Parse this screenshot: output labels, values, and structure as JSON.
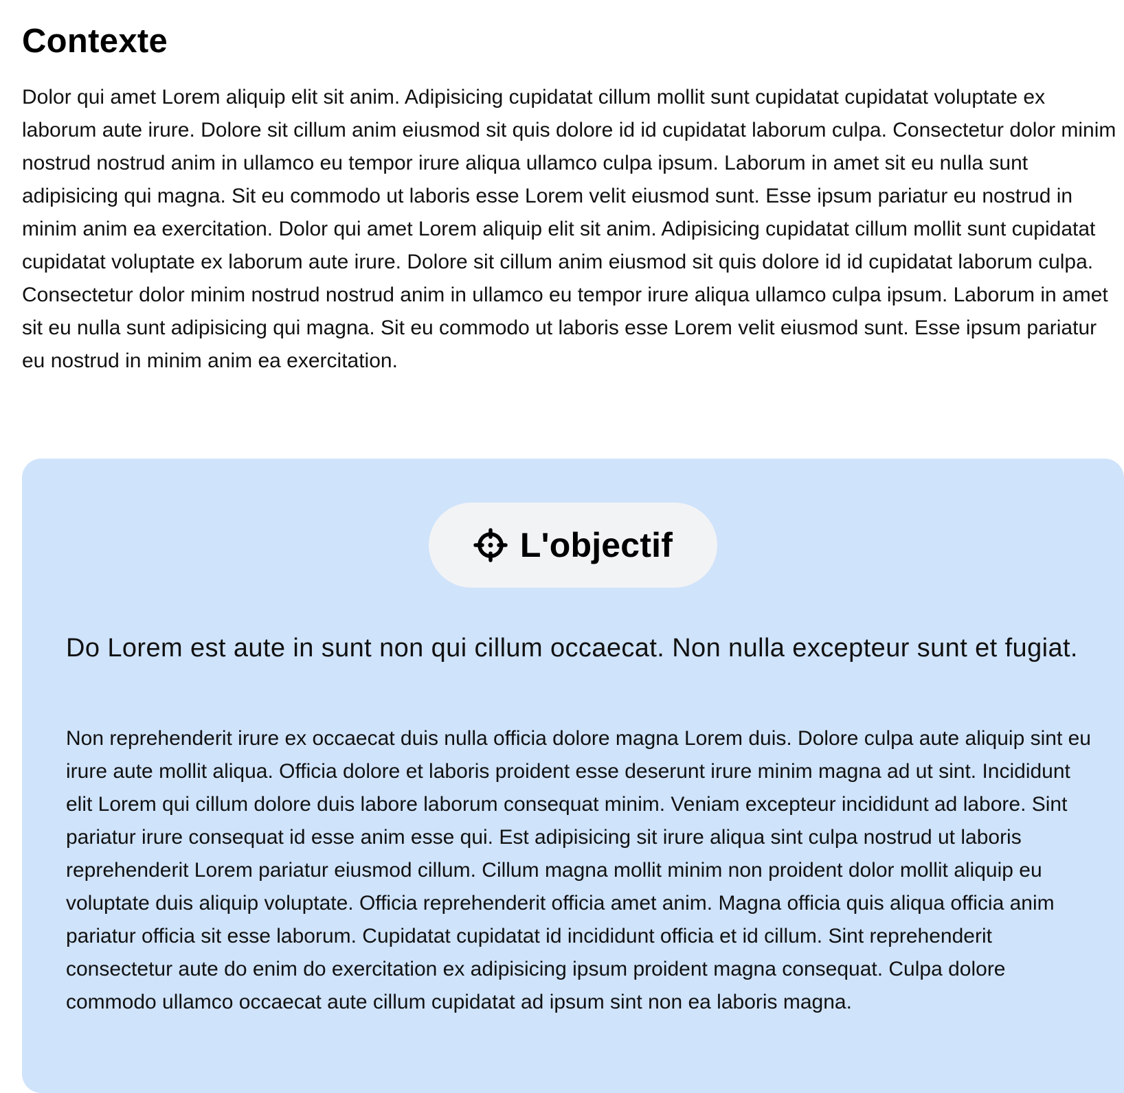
{
  "context": {
    "title": "Contexte",
    "body": "Dolor qui amet Lorem aliquip elit sit anim. Adipisicing cupidatat cillum mollit sunt cupidatat cupidatat voluptate ex laborum aute irure. Dolore sit cillum anim eiusmod sit quis dolore id id cupidatat laborum culpa. Consectetur dolor minim nostrud nostrud anim in ullamco eu tempor irure aliqua ullamco culpa ipsum. Laborum in amet sit eu nulla sunt adipisicing qui magna. Sit eu commodo ut laboris esse Lorem velit eiusmod sunt. Esse ipsum pariatur eu nostrud in minim anim ea exercitation. Dolor qui amet Lorem aliquip elit sit anim. Adipisicing cupidatat cillum mollit sunt cupidatat cupidatat voluptate ex laborum aute irure. Dolore sit cillum anim eiusmod sit quis dolore id id cupidatat laborum culpa. Consectetur dolor minim nostrud nostrud anim in ullamco eu tempor irure aliqua ullamco culpa ipsum. Laborum in amet sit eu nulla sunt adipisicing qui magna. Sit eu commodo ut laboris esse Lorem velit eiusmod sunt. Esse ipsum pariatur eu nostrud in minim anim ea exercitation."
  },
  "objective": {
    "icon": "target-icon",
    "label": "L'objectif",
    "lead": "Do Lorem est aute in sunt non qui cillum occaecat. Non nulla excepteur sunt et fugiat.",
    "body": "Non reprehenderit irure ex occaecat duis nulla officia dolore magna Lorem duis. Dolore culpa aute aliquip sint eu irure aute mollit aliqua. Officia dolore et laboris proident esse deserunt irure minim magna ad ut sint. Incididunt elit Lorem qui cillum dolore duis labore laborum consequat minim. Veniam excepteur incididunt ad labore. Sint pariatur irure consequat id esse anim esse qui. Est adipisicing sit irure aliqua sint culpa nostrud ut laboris reprehenderit Lorem pariatur eiusmod cillum. Cillum magna mollit minim non proident dolor mollit aliquip eu voluptate duis aliquip voluptate. Officia reprehenderit officia amet anim. Magna officia quis aliqua officia anim pariatur officia sit esse laborum. Cupidatat cupidatat id incididunt officia et id cillum. Sint reprehenderit consectetur aute do enim do exercitation ex adipisicing ipsum proident magna consequat. Culpa dolore commodo ullamco occaecat aute cillum cupidatat ad ipsum sint non ea laboris magna."
  },
  "colors": {
    "card_background": "#cfe3fb",
    "pill_background": "#f2f3f5",
    "text": "#111111"
  }
}
